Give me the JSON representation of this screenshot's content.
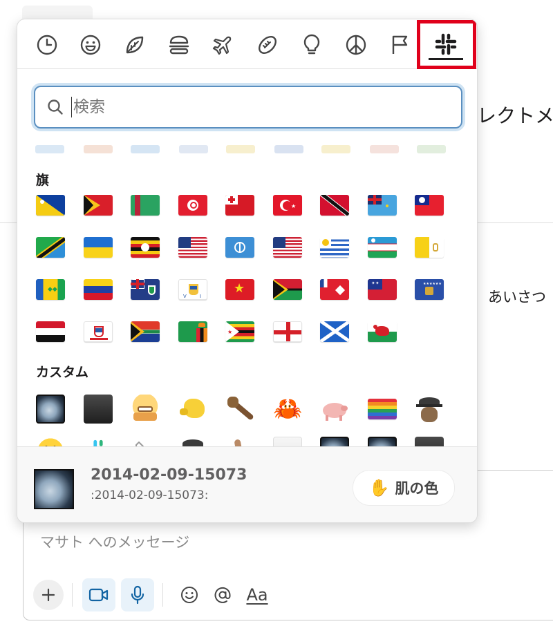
{
  "background": {
    "heading_fragment": "レクトメ",
    "message_fragment": "あいさつ",
    "composer": {
      "placeholder": "マサト へのメッセージ",
      "text_format_label": "Aa"
    }
  },
  "picker": {
    "categories": [
      {
        "icon": "clock-icon"
      },
      {
        "icon": "smiley-icon"
      },
      {
        "icon": "leaf-icon"
      },
      {
        "icon": "burger-icon"
      },
      {
        "icon": "airplane-icon"
      },
      {
        "icon": "football-icon"
      },
      {
        "icon": "lightbulb-icon"
      },
      {
        "icon": "peace-icon"
      },
      {
        "icon": "flag-icon"
      },
      {
        "icon": "slack-icon",
        "selected": true
      }
    ],
    "search": {
      "placeholder": "検索"
    },
    "sections": [
      {
        "title": "旗",
        "flags": [
          "Tokelau",
          "Timor-Leste",
          "Turkmenistan",
          "Tunisia",
          "Tonga",
          "Turkey",
          "Trinidad and Tobago",
          "Tuvalu",
          "Taiwan",
          "Tanzania",
          "Ukraine",
          "Uganda",
          "United States Minor Outlying Islands",
          "United Nations",
          "United States",
          "Uruguay",
          "Uzbekistan",
          "Vatican City",
          "St. Vincent and Grenadines",
          "Venezuela",
          "British Virgin Islands",
          "U.S. Virgin Islands",
          "Vietnam",
          "Vanuatu",
          "Wallis and Futuna",
          "Samoa",
          "Kosovo",
          "Yemen",
          "Mayotte",
          "South Africa",
          "Zambia",
          "Zimbabwe",
          "England",
          "Scotland",
          "Wales"
        ]
      },
      {
        "title": "カスタム",
        "emojis": [
          "2014-02-09-15073",
          "black-square",
          "grimacing-face-emoji",
          "yellow-fist",
          "wooden-club",
          "crab-emoji",
          "pig-emoji",
          "rainbow-flag",
          "detective-mole",
          "smiley-face",
          "slack-logo",
          "phone-receiver",
          "detective-mole-2",
          "thumbs-up",
          "blank-square",
          "photo-2",
          "photo-3",
          "black-square-2"
        ]
      }
    ],
    "footer": {
      "name": "2014-02-09-15073",
      "code": ":2014-02-09-15073:",
      "skin_tone_label": "肌の色",
      "skin_tone_emoji": "✋"
    }
  },
  "colors": {
    "highlight_border": "#e0001b",
    "search_focus": "#5a8fc0"
  }
}
